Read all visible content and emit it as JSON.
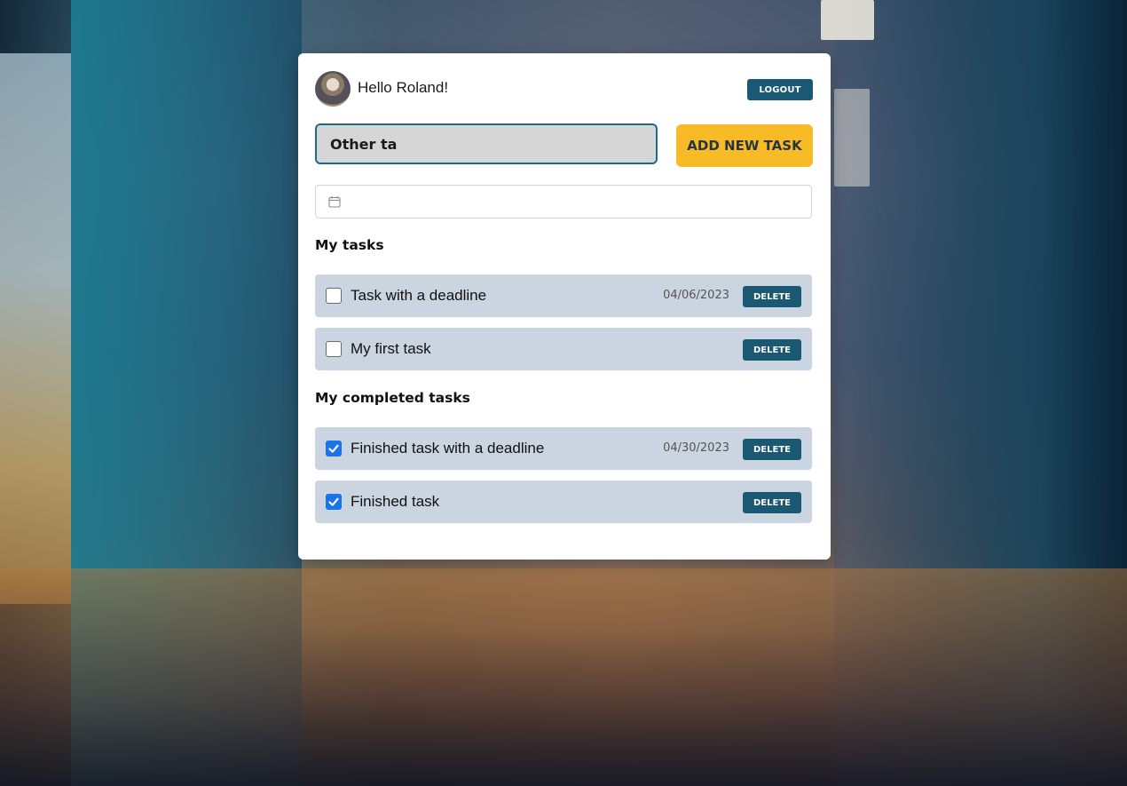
{
  "header": {
    "greeting": "Hello Roland!",
    "logout_label": "LOGOUT"
  },
  "new_task": {
    "input_value": "Other ta",
    "add_label": "ADD NEW TASK",
    "date_value": ""
  },
  "sections": {
    "open_title": "My tasks",
    "completed_title": "My completed tasks"
  },
  "open_tasks": [
    {
      "label": "Task with a deadline",
      "deadline": "04/06/2023",
      "completed": false,
      "delete_label": "DELETE"
    },
    {
      "label": "My first task",
      "deadline": "",
      "completed": false,
      "delete_label": "DELETE"
    }
  ],
  "completed_tasks": [
    {
      "label": "Finished task with a deadline",
      "deadline": "04/30/2023",
      "completed": true,
      "delete_label": "DELETE"
    },
    {
      "label": "Finished task",
      "deadline": "",
      "completed": true,
      "delete_label": "DELETE"
    }
  ],
  "colors": {
    "primary": "#1a5873",
    "accent": "#f8bb28",
    "row_bg": "#cbd5e1",
    "checkbox_checked": "#1a73e8"
  },
  "icons": {
    "calendar": "calendar-icon",
    "checkmark": "checkmark-icon"
  }
}
